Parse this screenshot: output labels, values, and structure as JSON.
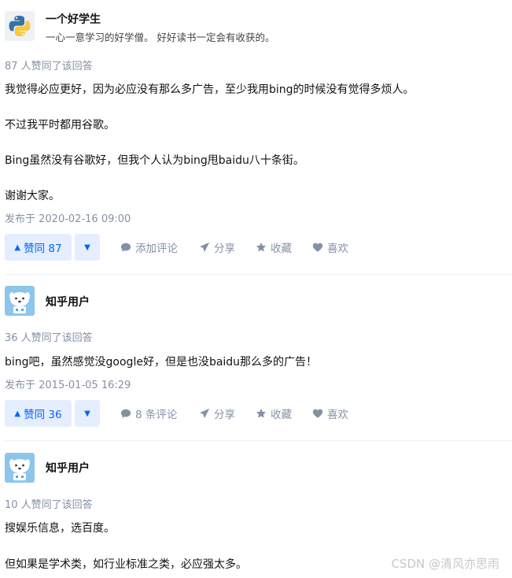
{
  "answers": [
    {
      "author": {
        "name": "一个好学生",
        "bio": "一心一意学习的好学僧。 好好读书一定会有收获的。",
        "avatar_icon": "python-logo-icon"
      },
      "vote_count_text": "87 人赞同了该回答",
      "paragraphs": [
        "我觉得必应更好，因为必应没有那么多广告，至少我用bing的时候没有觉得多烦人。",
        "不过我平时都用谷歌。",
        "Bing虽然没有谷歌好，但我个人认为bing甩baidu八十条街。",
        "谢谢大家。"
      ],
      "published": "发布于 2020-02-16 09:00",
      "actions": {
        "upvote": "赞同 87",
        "comment": "添加评论",
        "share": "分享",
        "collect": "收藏",
        "like": "喜欢"
      }
    },
    {
      "author": {
        "name": "知乎用户",
        "avatar_icon": "zhihu-default-avatar-icon"
      },
      "vote_count_text": "36 人赞同了该回答",
      "paragraphs": [
        "bing吧，虽然感觉没google好，但是也没baidu那么多的广告！"
      ],
      "published": "发布于 2015-01-05 16:29",
      "actions": {
        "upvote": "赞同 36",
        "comment": "8 条评论",
        "share": "分享",
        "collect": "收藏",
        "like": "喜欢"
      }
    },
    {
      "author": {
        "name": "知乎用户",
        "avatar_icon": "zhihu-default-avatar-icon"
      },
      "vote_count_text": "10 人赞同了该回答",
      "paragraphs": [
        "搜娱乐信息，选百度。",
        "但如果是学术类，如行业标准之类，必应强太多。"
      ]
    }
  ],
  "watermark": "CSDN @清风亦思雨",
  "colors": {
    "accent": "#0066ff",
    "accent_bg": "#e5eeff",
    "meta": "#8590a6"
  }
}
